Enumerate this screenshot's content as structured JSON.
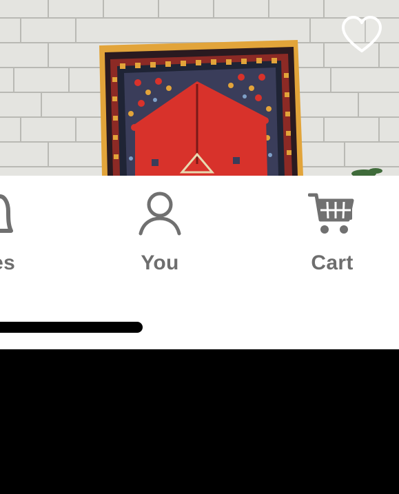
{
  "product": {
    "image_alt": "rug-photo",
    "favorite_icon": "heart-outline-icon"
  },
  "tabbar": {
    "items": [
      {
        "label": "tes",
        "icon": "bell-icon"
      },
      {
        "label": "You",
        "icon": "person-icon"
      },
      {
        "label": "Cart",
        "icon": "cart-icon"
      }
    ]
  },
  "colors": {
    "tab_label": "#6e6e6e",
    "tab_icon": "#707070",
    "background": "#ffffff",
    "rug_red": "#d8322b",
    "rug_border": "#e2a43a"
  }
}
